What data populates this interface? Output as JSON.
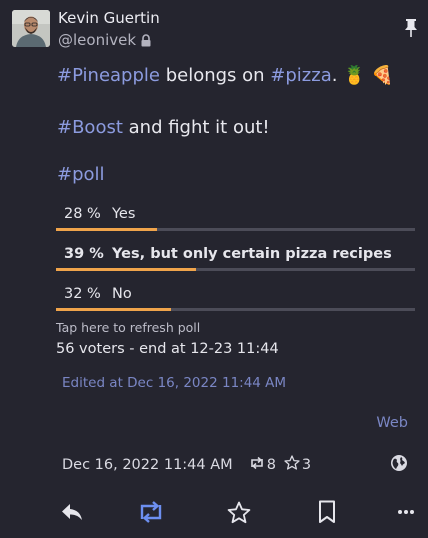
{
  "author": {
    "name": "Kevin Guertin",
    "handle": "@leonivek"
  },
  "post": {
    "line1": {
      "tag1": "#Pineapple",
      "text1": " belongs on ",
      "tag2": "#pizza",
      "text2": ". 🍍 🍕"
    },
    "line2": {
      "tag": "#Boost",
      "text": " and fight it out!"
    },
    "line3": {
      "tag": "#poll"
    }
  },
  "poll": {
    "options": [
      {
        "percent": "28 %",
        "label": "Yes",
        "fraction": 0.28,
        "leading": false
      },
      {
        "percent": "39 %",
        "label": "Yes, but only certain pizza recipes",
        "fraction": 0.39,
        "leading": true
      },
      {
        "percent": "32 %",
        "label": "No",
        "fraction": 0.32,
        "leading": false
      }
    ],
    "refresh_hint": "Tap here to refresh poll",
    "voters_line": "56 voters - end at 12-23 11:44"
  },
  "edited": "Edited at Dec 16, 2022 11:44 AM",
  "source": "Web",
  "meta": {
    "timestamp": "Dec 16, 2022 11:44 AM",
    "boosts": "8",
    "favourites": "3"
  },
  "colors": {
    "background": "#25252f",
    "hashtag": "#8c9bdf",
    "poll_bar": "#f0a44b",
    "boost_active": "#6d8ff0"
  },
  "icons": {
    "pin": "pin-icon",
    "lock": "lock-icon",
    "boost": "boost-icon",
    "star": "star-icon",
    "globe": "globe-icon",
    "reply": "reply-icon",
    "bookmark": "bookmark-icon",
    "more": "more-icon"
  }
}
